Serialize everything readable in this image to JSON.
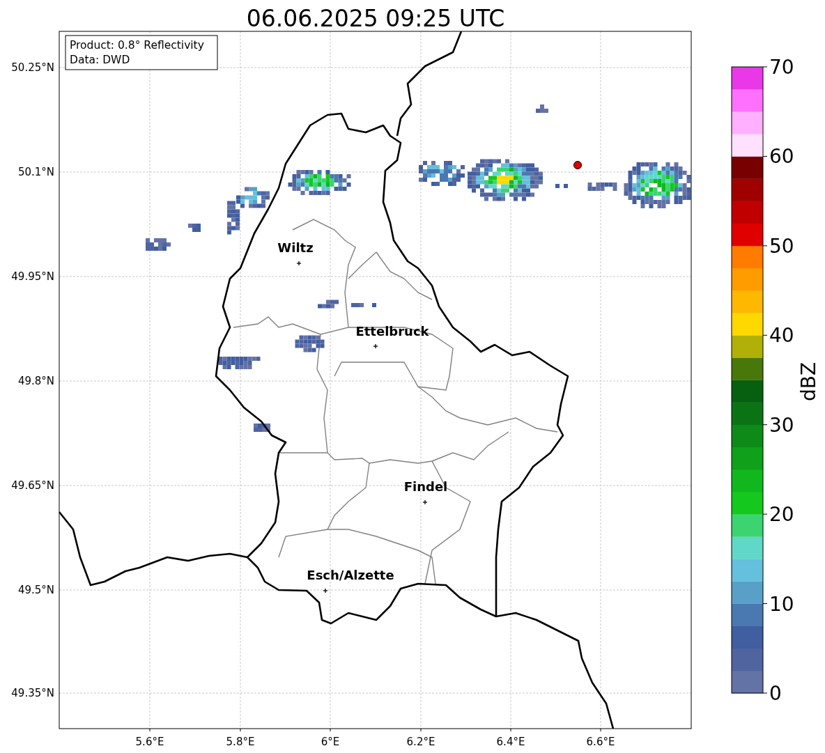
{
  "title": "06.06.2025 09:25 UTC",
  "info_box": [
    "Product: 0.8° Reflectivity",
    "Data: DWD"
  ],
  "x_ticks": [
    "5.6°E",
    "5.8°E",
    "6°E",
    "6.2°E",
    "6.4°E",
    "6.6°E"
  ],
  "y_ticks": [
    "50.25°N",
    "50.1°N",
    "49.95°N",
    "49.8°N",
    "49.65°N",
    "49.5°N",
    "49.35°N"
  ],
  "cities": [
    {
      "name": "Wiltz"
    },
    {
      "name": "Ettelbruck"
    },
    {
      "name": "Findel"
    },
    {
      "name": "Esch/Alzette"
    }
  ],
  "colorbar": {
    "label": "dBZ",
    "ticks": [
      "70",
      "60",
      "50",
      "40",
      "30",
      "20",
      "10",
      "0"
    ],
    "segments": [
      {
        "color": "#6473a6"
      },
      {
        "color": "#5064a0"
      },
      {
        "color": "#405ea0"
      },
      {
        "color": "#4a78b0"
      },
      {
        "color": "#58a0c8"
      },
      {
        "color": "#64c0dc"
      },
      {
        "color": "#60d8c8"
      },
      {
        "color": "#3cd470"
      },
      {
        "color": "#14c81e"
      },
      {
        "color": "#10b81e"
      },
      {
        "color": "#10a01a"
      },
      {
        "color": "#0e8a18"
      },
      {
        "color": "#0a7414"
      },
      {
        "color": "#066010"
      },
      {
        "color": "#48780a"
      },
      {
        "color": "#b0b008"
      },
      {
        "color": "#ffd800"
      },
      {
        "color": "#ffb800"
      },
      {
        "color": "#ff9c00"
      },
      {
        "color": "#ff7c00"
      },
      {
        "color": "#e00000"
      },
      {
        "color": "#c00000"
      },
      {
        "color": "#a00000"
      },
      {
        "color": "#780000"
      },
      {
        "color": "#ffe0ff"
      },
      {
        "color": "#ffb0ff"
      },
      {
        "color": "#ff70ff"
      },
      {
        "color": "#e838e8"
      }
    ]
  }
}
